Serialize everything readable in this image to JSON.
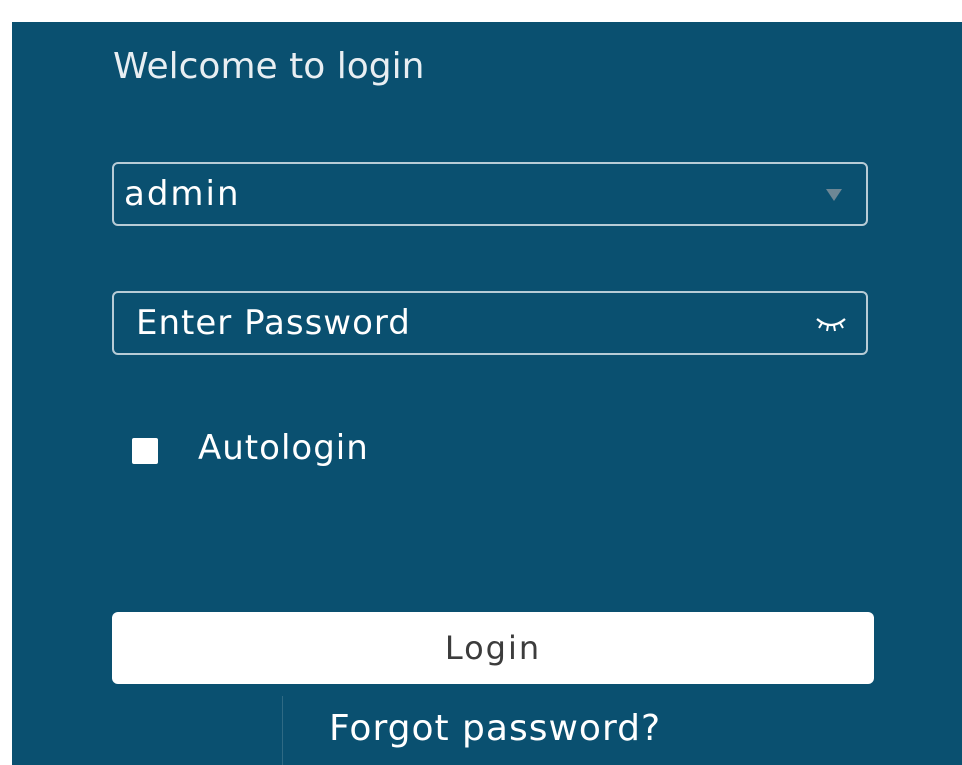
{
  "header": {
    "title": "Welcome to login"
  },
  "username": {
    "value": "admin",
    "icon": "chevron-down-icon"
  },
  "password": {
    "placeholder": "Enter Password",
    "icon": "eye-closed-icon"
  },
  "autologin": {
    "label": "Autologin",
    "checked": false
  },
  "actions": {
    "login_label": "Login",
    "forgot_label": "Forgot password?"
  },
  "colors": {
    "background": "#0a5070",
    "field_border": "#b8ccd6",
    "button_bg": "#ffffff",
    "text": "#ffffff"
  }
}
